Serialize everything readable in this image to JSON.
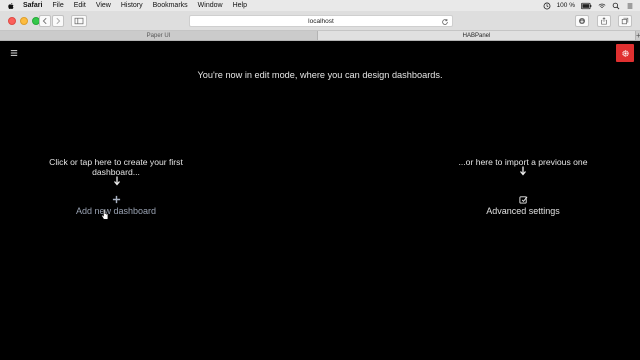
{
  "menubar": {
    "app_name": "Safari",
    "items": [
      "File",
      "Edit",
      "View",
      "History",
      "Bookmarks",
      "Window",
      "Help"
    ],
    "battery_text": "100 %",
    "icons": [
      "apple-icon",
      "clock-icon",
      "wifi-icon",
      "battery-icon",
      "search-icon",
      "list-icon"
    ]
  },
  "browser": {
    "url": "localhost",
    "tabs": [
      {
        "label": "Paper UI",
        "active": false
      },
      {
        "label": "HABPanel",
        "active": true
      }
    ],
    "new_tab_label": "+"
  },
  "habpanel": {
    "edit_message": "You're now in edit mode, where you can design dashboards.",
    "hint_left": "Click or tap here to create your first dashboard...",
    "hint_right": "...or here to import a previous one",
    "add_dashboard_label": "Add new dashboard",
    "advanced_settings_label": "Advanced settings",
    "accent_color": "#e03030"
  }
}
